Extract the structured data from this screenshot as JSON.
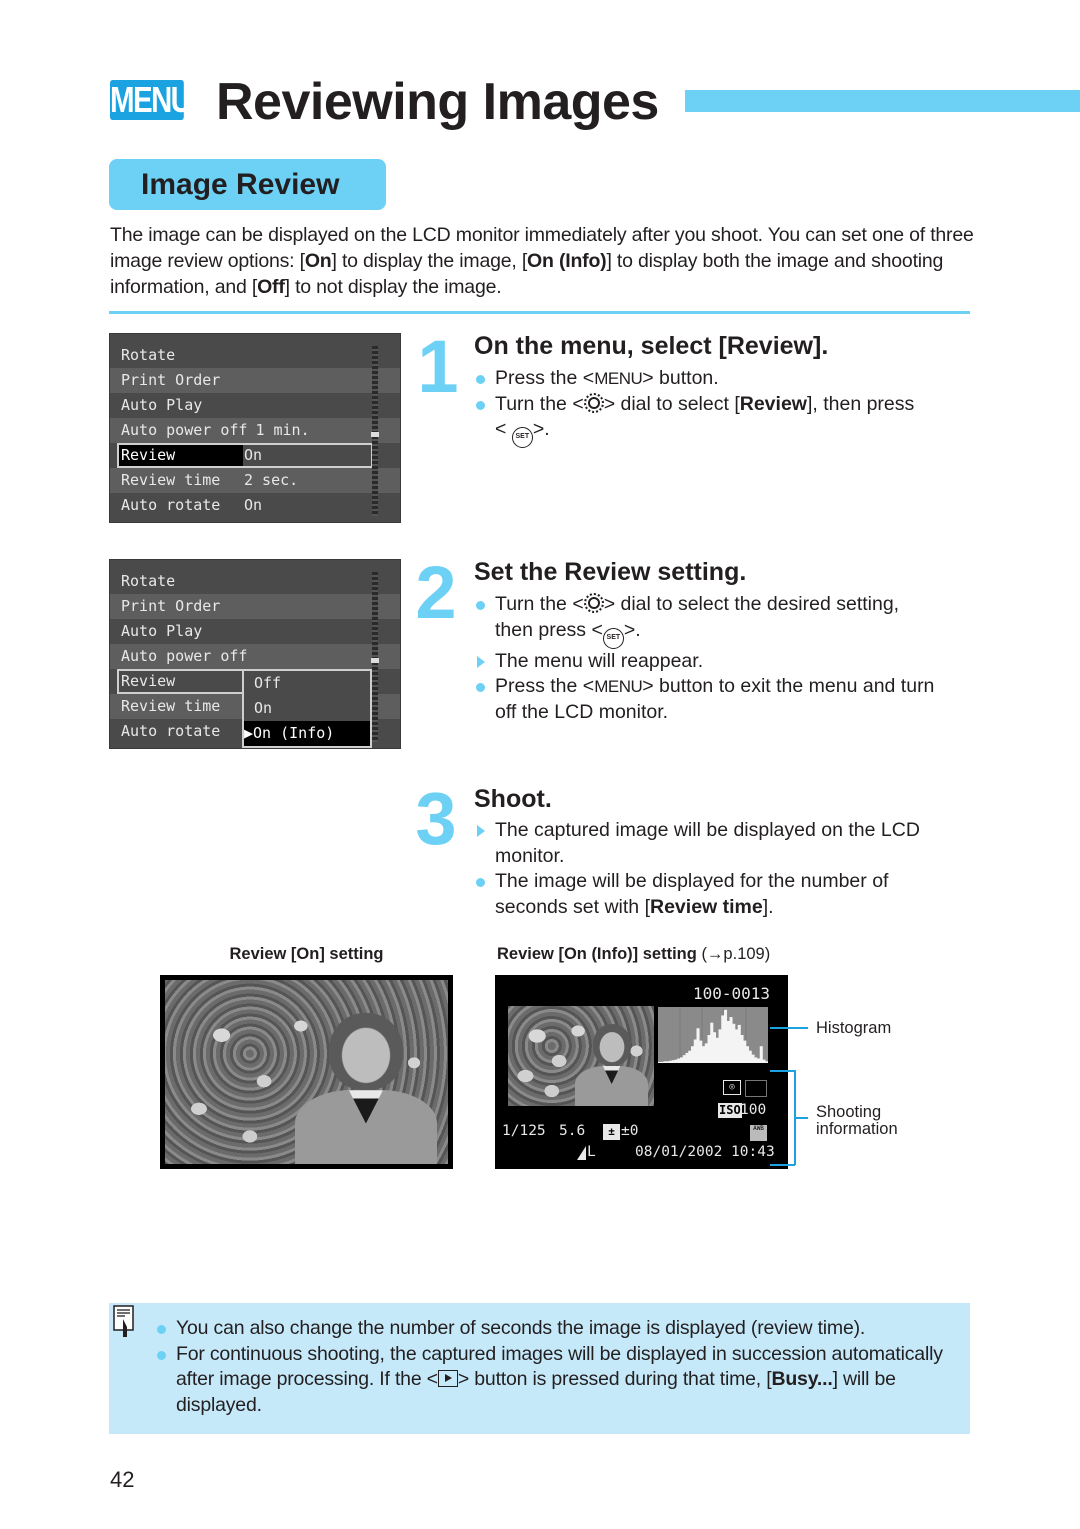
{
  "header": {
    "menu_badge": "MENU",
    "title": "Reviewing Images"
  },
  "section": {
    "title": "Image Review",
    "intro": {
      "p1": "The image can be displayed on the LCD monitor immediately after you shoot. You can set one of three image review options: [",
      "on": "On",
      "p2": "] to display the image, [",
      "on_info": "On (Info)",
      "p3": "] to display both the image and shooting information, and [",
      "off": "Off",
      "p4": "] to not display the image."
    }
  },
  "lcd_menu_1": {
    "items": [
      {
        "name": "Rotate",
        "value": ""
      },
      {
        "name": "Print Order",
        "value": ""
      },
      {
        "name": "Auto Play",
        "value": ""
      },
      {
        "name": "Auto power off",
        "value": "1 min.",
        "inline": true
      },
      {
        "name": "Review",
        "value": "On",
        "selected": true
      },
      {
        "name": "Review time",
        "value": "2 sec."
      },
      {
        "name": "Auto rotate",
        "value": "On"
      }
    ]
  },
  "lcd_menu_2": {
    "items": [
      {
        "name": "Rotate"
      },
      {
        "name": "Print Order"
      },
      {
        "name": "Auto Play"
      },
      {
        "name": "Auto power off"
      },
      {
        "name": "Review",
        "selected": true
      },
      {
        "name": "Review time"
      },
      {
        "name": "Auto rotate"
      }
    ],
    "options": [
      "Off",
      "On",
      "On (Info)"
    ],
    "active_option": "On (Info)",
    "cursor": "▶"
  },
  "steps": [
    {
      "number": "1",
      "title": "On the menu, select [Review].",
      "b1_pre": "Press the <",
      "b1_key": "MENU",
      "b1_post": "> button.",
      "b2_pre": "Turn the <",
      "b2_mid": "> dial to select [",
      "b2_bold": "Review",
      "b2_post": "], then press",
      "b3_pre": "<",
      "b3_post": ">."
    },
    {
      "number": "2",
      "title": "Set the Review setting.",
      "b1_pre": "Turn the <",
      "b1_post": "> dial to select the desired setting,",
      "b1_line2_pre": "then press <",
      "b1_line2_post": ">.",
      "b2": "The menu will reappear.",
      "b3_pre": "Press the <",
      "b3_key": "MENU",
      "b3_post": "> button to exit the menu and turn off the LCD monitor."
    },
    {
      "number": "3",
      "title": "Shoot.",
      "b1": "The captured image will be displayed on the LCD monitor.",
      "b2_pre": "The image will be displayed for the number of seconds set with [",
      "b2_bold": "Review time",
      "b2_post": "]."
    }
  ],
  "icons": {
    "set_label": "SET"
  },
  "captions": {
    "review_on": "Review [On] setting",
    "review_on_info": "Review [On (Info)] setting",
    "review_on_info_ref": "(→p.109)"
  },
  "lcd_info": {
    "file_number": "100-0013",
    "shutter": "1/125",
    "aperture": "5.6",
    "exposure_comp": "±0",
    "iso_label": "ISO",
    "iso": "100",
    "quality": "L",
    "date_time": "08/01/2002 10:43",
    "awb": "AWB",
    "histogram": [
      0.02,
      0.02,
      0.03,
      0.03,
      0.04,
      0.05,
      0.06,
      0.08,
      0.1,
      0.14,
      0.18,
      0.22,
      0.3,
      0.42,
      0.62,
      0.4,
      0.3,
      0.35,
      0.5,
      0.72,
      0.55,
      0.45,
      0.6,
      0.85,
      0.95,
      0.75,
      0.82,
      0.7,
      0.6,
      0.68,
      0.5,
      0.4,
      0.3,
      0.22,
      0.15,
      0.1,
      0.08,
      0.3,
      0.06,
      0.03
    ]
  },
  "callouts": {
    "histogram": "Histogram",
    "shooting_info_l1": "Shooting",
    "shooting_info_l2": "information"
  },
  "note": {
    "b1": "You can also change the number of seconds the image is displayed (review time).",
    "b2_pre": "For continuous shooting, the captured images will be displayed in succession automatically after image processing. If the <",
    "b2_mid": "> button is pressed during that time, [",
    "b2_bold": "Busy...",
    "b2_post": "] will be displayed."
  },
  "page_number": "42",
  "colors": {
    "accent": "#6dd0f5",
    "badge": "#1aa3e0",
    "note_bg": "#c6e9fa"
  }
}
